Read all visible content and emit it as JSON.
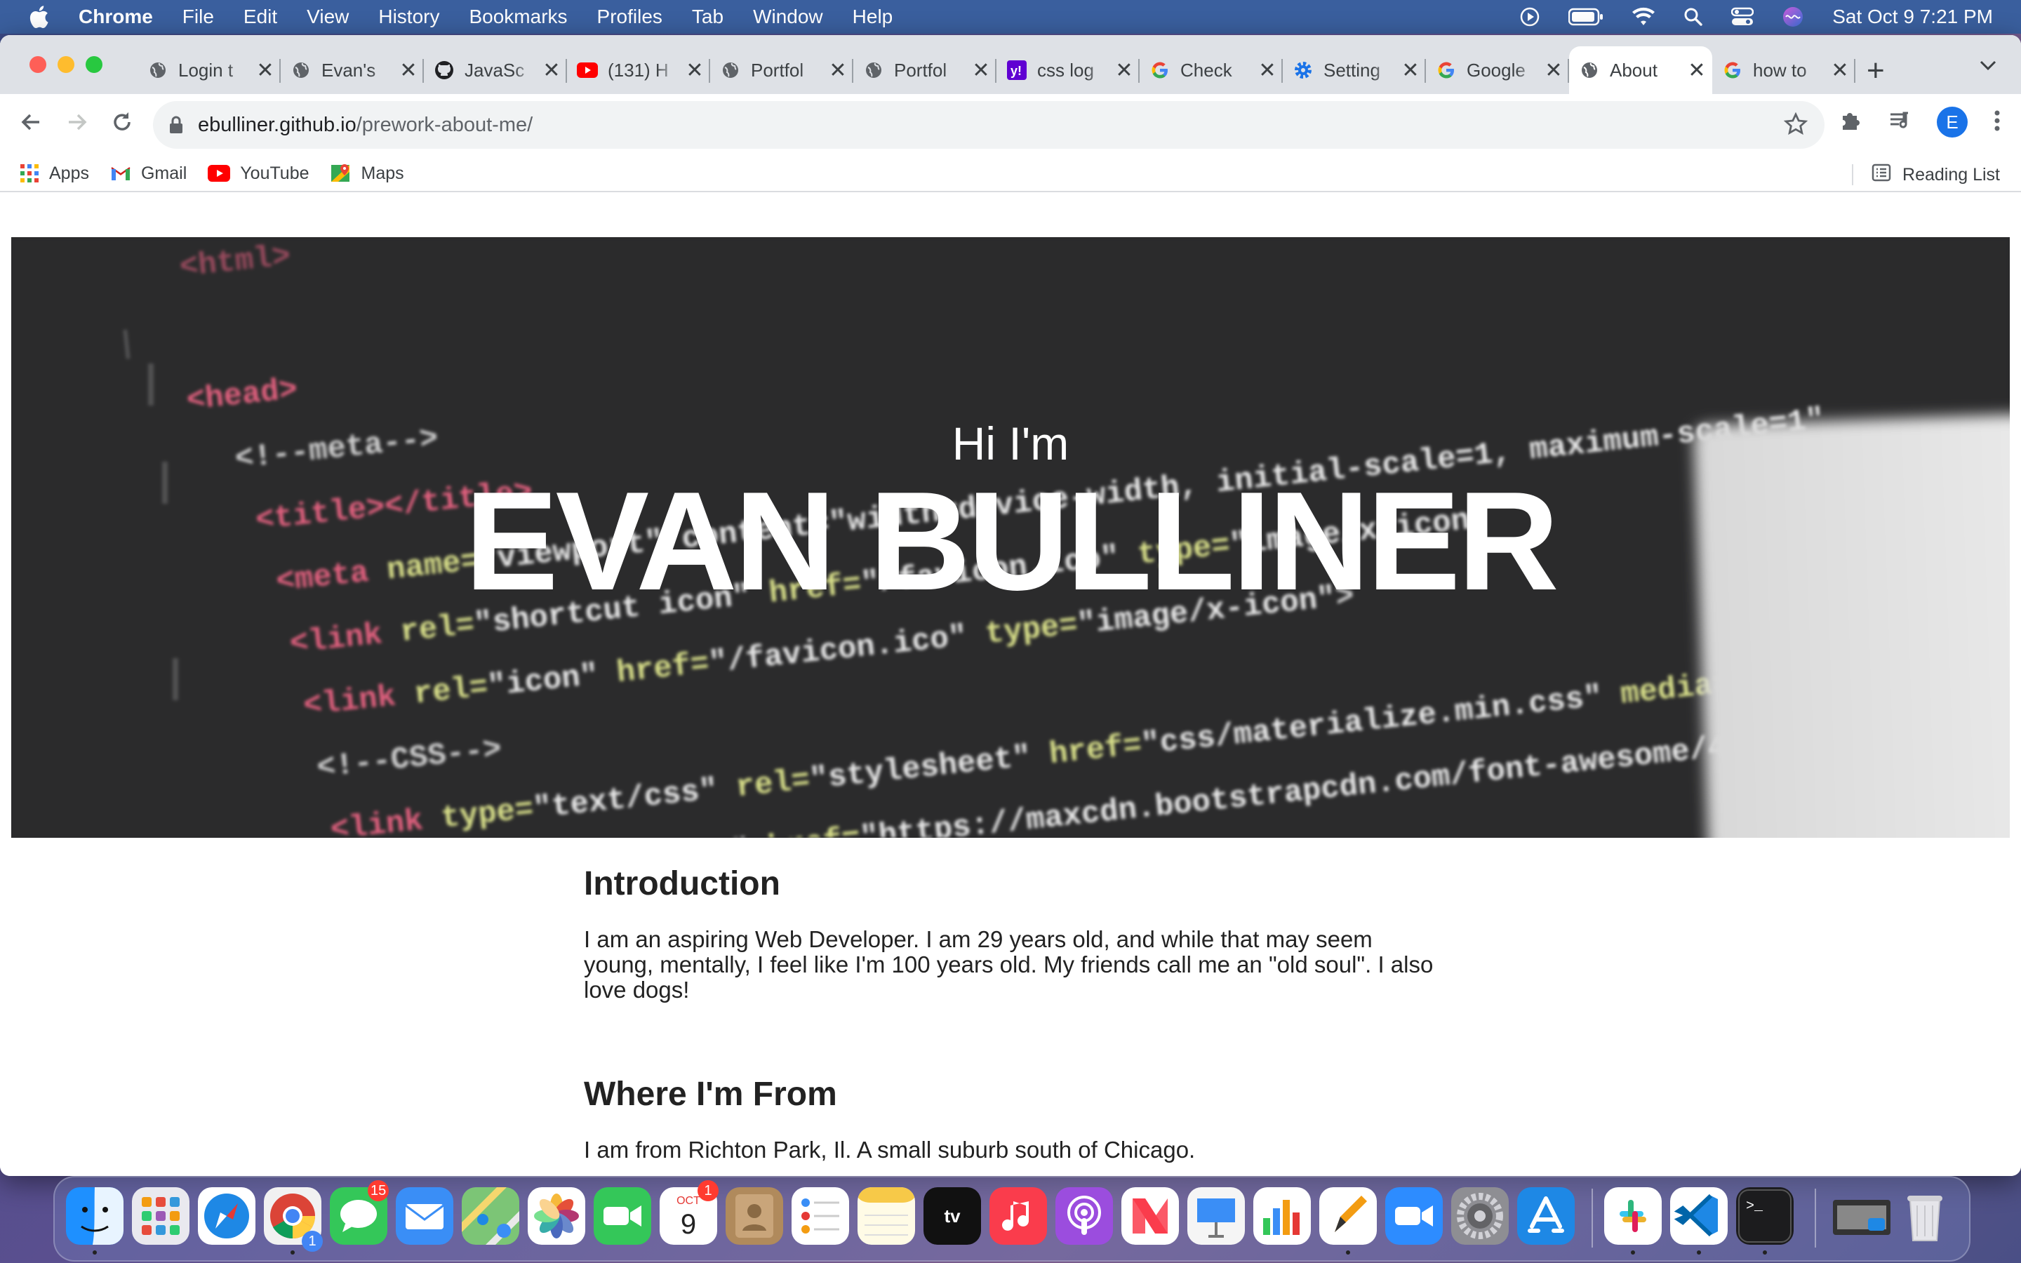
{
  "menubar": {
    "app_name": "Chrome",
    "items": [
      "File",
      "Edit",
      "View",
      "History",
      "Bookmarks",
      "Profiles",
      "Tab",
      "Window",
      "Help"
    ],
    "clock": "Sat Oct 9  7:21 PM"
  },
  "tabs": [
    {
      "title": "Login t",
      "icon": "globe-icon"
    },
    {
      "title": "Evan's",
      "icon": "globe-icon"
    },
    {
      "title": "JavaSc",
      "icon": "github-icon"
    },
    {
      "title": "(131) H",
      "icon": "youtube-icon"
    },
    {
      "title": "Portfol",
      "icon": "globe-icon"
    },
    {
      "title": "Portfol",
      "icon": "globe-icon"
    },
    {
      "title": "css log",
      "icon": "yahoo-icon"
    },
    {
      "title": "Check",
      "icon": "google-icon"
    },
    {
      "title": "Setting",
      "icon": "gear-icon"
    },
    {
      "title": "Google",
      "icon": "google-icon"
    },
    {
      "title": "About",
      "icon": "globe-icon",
      "active": true
    },
    {
      "title": "how to",
      "icon": "google-icon"
    }
  ],
  "omnibox": {
    "host": "ebulliner.github.io",
    "path": "/prework-about-me/"
  },
  "profile_initial": "E",
  "bookmarks": [
    "Apps",
    "Gmail",
    "YouTube",
    "Maps"
  ],
  "reading_list": "Reading List",
  "hero": {
    "greeting": "Hi I'm",
    "name": "EVAN BULLINER"
  },
  "sections": [
    {
      "heading": "Introduction",
      "body": "I am an aspiring Web Developer. I am 29 years old, and while that may seem young, mentally, I feel like I'm 100 years old. My friends call me an \"old soul\". I also love dogs!"
    },
    {
      "heading": "Where I'm From",
      "body": "I am from Richton Park, Il. A small suburb south of Chicago."
    }
  ],
  "dock": {
    "messages_badge": "15",
    "calendar_month": "OCT",
    "calendar_day": "9",
    "calendar_badge": "1",
    "chrome_badge": "1"
  },
  "colors": {
    "menubar": "#3a5f9e",
    "tabstrip": "#dee1e6",
    "hero_bg": "#2a2a2b"
  }
}
